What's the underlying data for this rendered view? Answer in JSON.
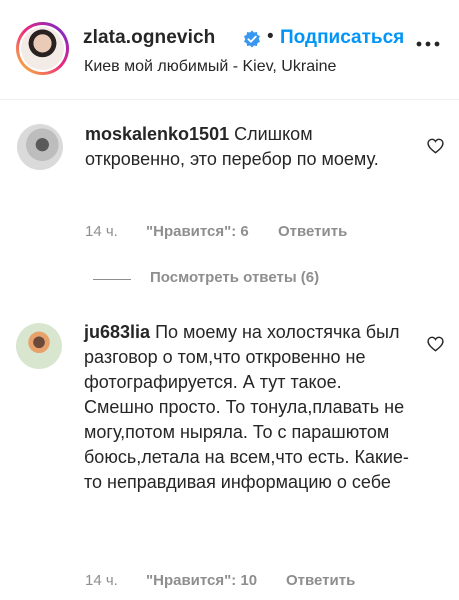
{
  "header": {
    "username": "zlata.ognevich",
    "separator": "•",
    "follow_label": "Подписаться",
    "location": "Киев мой любимый - Kiev, Ukraine",
    "verified_icon": "verified-badge-icon",
    "more_icon": "more-options-icon"
  },
  "colors": {
    "link": "#0095f6",
    "muted": "#8e8e8e",
    "text": "#262626"
  },
  "comments": [
    {
      "username": "moskalenko1501",
      "text": "Слишком откровенно, это перебор по моему.",
      "time": "14 ч.",
      "likes_label": "\"Нравится\": 6",
      "reply_label": "Ответить"
    },
    {
      "username": "ju683lia",
      "text": "По моему на холостячка был разговор о том,что откровенно не фотографируется. А тут такое. Смешно просто. То тонула,плавать не могу,потом ныряла. То с парашютом боюсь,летала на всем,что есть. Какие-то неправдивая информацию о себе",
      "time": "14 ч.",
      "likes_label": "\"Нравится\": 10",
      "reply_label": "Ответить"
    }
  ],
  "view_replies_label": "Посмотреть ответы (6)"
}
